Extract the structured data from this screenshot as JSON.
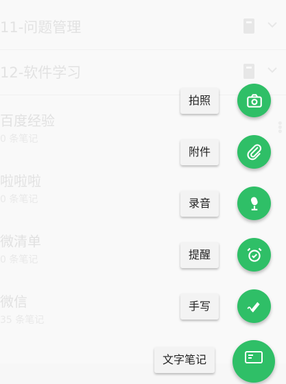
{
  "sections": [
    {
      "title": "11-问题管理"
    },
    {
      "title": "12-软件学习"
    }
  ],
  "notes": [
    {
      "title": "百度经验",
      "count": "0 条笔记"
    },
    {
      "title": "啦啦啦",
      "count": "0 条笔记"
    },
    {
      "title": "微清单",
      "count": "0 条笔记"
    },
    {
      "title": "微信",
      "count": "35 条笔记"
    }
  ],
  "fab_menu": [
    {
      "label": "拍照",
      "icon": "camera-icon"
    },
    {
      "label": "附件",
      "icon": "paperclip-icon"
    },
    {
      "label": "录音",
      "icon": "microphone-icon"
    },
    {
      "label": "提醒",
      "icon": "alarm-clock-icon"
    },
    {
      "label": "手写",
      "icon": "pen-icon"
    },
    {
      "label": "文字笔记",
      "icon": "text-note-icon"
    }
  ],
  "colors": {
    "accent": "#2fbf67"
  }
}
